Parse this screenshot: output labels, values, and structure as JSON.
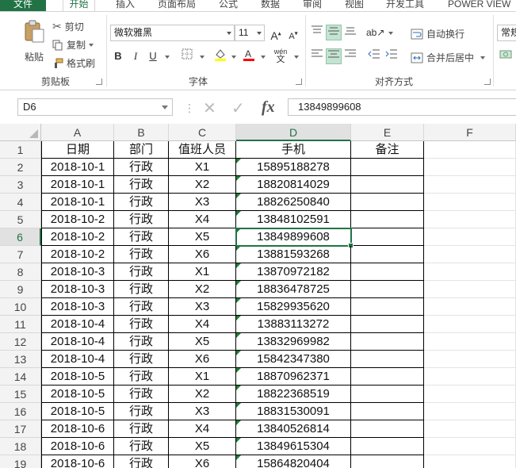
{
  "tabs": [
    {
      "label": "文件",
      "kind": "file"
    },
    {
      "label": "开始",
      "kind": "active"
    },
    {
      "label": "插入"
    },
    {
      "label": "页面布局"
    },
    {
      "label": "公式"
    },
    {
      "label": "数据"
    },
    {
      "label": "审阅"
    },
    {
      "label": "视图"
    },
    {
      "label": "开发工具"
    },
    {
      "label": "POWER VIEW"
    }
  ],
  "clipboard": {
    "paste_label": "粘贴",
    "cut_label": "剪切",
    "copy_label": "复制",
    "format_painter_label": "格式刷",
    "group_label": "剪贴板"
  },
  "font": {
    "name": "微软雅黑",
    "size": "11",
    "bold": "B",
    "italic": "I",
    "underline": "U",
    "phonetic": "wén",
    "group_label": "字体",
    "fill_color": "#ffff00",
    "font_color": "#ff0000"
  },
  "alignment": {
    "wrap_label": "自动换行",
    "merge_label": "合并后居中",
    "group_label": "对齐方式"
  },
  "number": {
    "format": "常规"
  },
  "formula_bar": {
    "name_box": "D6",
    "fx": "fx",
    "content": "13849899608"
  },
  "grid": {
    "columns": [
      "A",
      "B",
      "C",
      "D",
      "E",
      "F"
    ],
    "selected_column": "D",
    "selected_row": 6,
    "headers": [
      "日期",
      "部门",
      "值班人员",
      "手机",
      "备注"
    ],
    "rows": [
      {
        "num": "2",
        "date": "2018-10-1",
        "dept": "行政",
        "person": "X1",
        "phone": "15895188278"
      },
      {
        "num": "3",
        "date": "2018-10-1",
        "dept": "行政",
        "person": "X2",
        "phone": "18820814029"
      },
      {
        "num": "4",
        "date": "2018-10-1",
        "dept": "行政",
        "person": "X3",
        "phone": "18826250840"
      },
      {
        "num": "5",
        "date": "2018-10-2",
        "dept": "行政",
        "person": "X4",
        "phone": "13848102591"
      },
      {
        "num": "6",
        "date": "2018-10-2",
        "dept": "行政",
        "person": "X5",
        "phone": "13849899608"
      },
      {
        "num": "7",
        "date": "2018-10-2",
        "dept": "行政",
        "person": "X6",
        "phone": "13881593268"
      },
      {
        "num": "8",
        "date": "2018-10-3",
        "dept": "行政",
        "person": "X1",
        "phone": "13870972182"
      },
      {
        "num": "9",
        "date": "2018-10-3",
        "dept": "行政",
        "person": "X2",
        "phone": "18836478725"
      },
      {
        "num": "10",
        "date": "2018-10-3",
        "dept": "行政",
        "person": "X3",
        "phone": "15829935620"
      },
      {
        "num": "11",
        "date": "2018-10-4",
        "dept": "行政",
        "person": "X4",
        "phone": "13883113272"
      },
      {
        "num": "12",
        "date": "2018-10-4",
        "dept": "行政",
        "person": "X5",
        "phone": "13832969982"
      },
      {
        "num": "13",
        "date": "2018-10-4",
        "dept": "行政",
        "person": "X6",
        "phone": "15842347380"
      },
      {
        "num": "14",
        "date": "2018-10-5",
        "dept": "行政",
        "person": "X1",
        "phone": "18870962371"
      },
      {
        "num": "15",
        "date": "2018-10-5",
        "dept": "行政",
        "person": "X2",
        "phone": "18822368519"
      },
      {
        "num": "16",
        "date": "2018-10-5",
        "dept": "行政",
        "person": "X3",
        "phone": "18831530091"
      },
      {
        "num": "17",
        "date": "2018-10-6",
        "dept": "行政",
        "person": "X4",
        "phone": "13840526814"
      },
      {
        "num": "18",
        "date": "2018-10-6",
        "dept": "行政",
        "person": "X5",
        "phone": "13849615304"
      },
      {
        "num": "19",
        "date": "2018-10-6",
        "dept": "行政",
        "person": "X6",
        "phone": "15864820404"
      }
    ]
  },
  "colors": {
    "accent": "#217346",
    "error_indicator": "#1e7e34"
  }
}
